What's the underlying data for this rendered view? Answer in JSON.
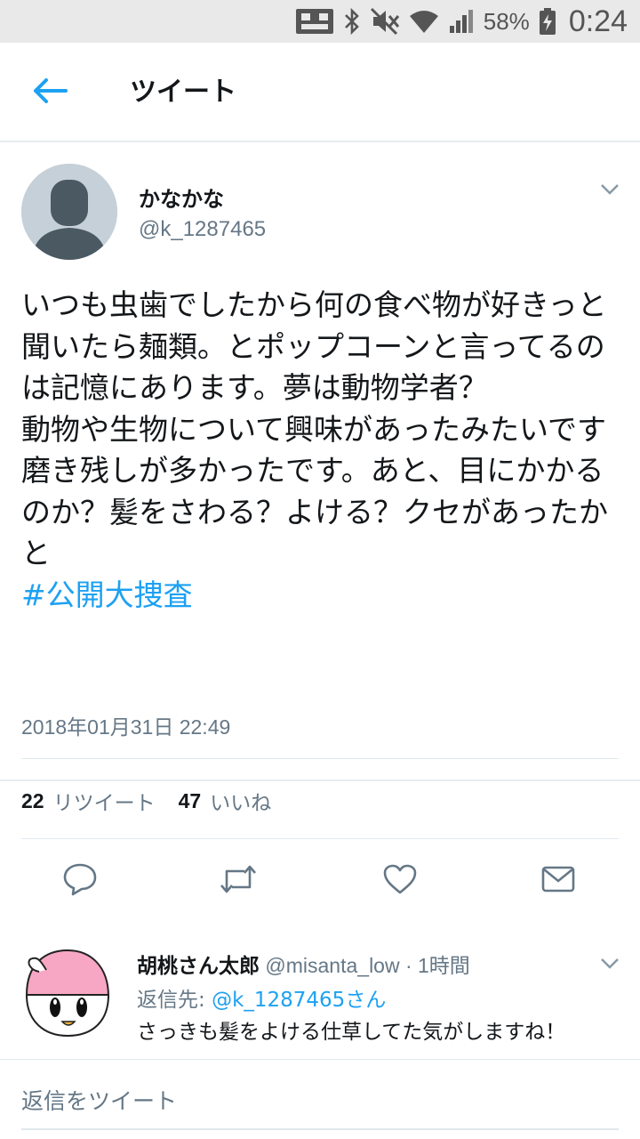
{
  "status_bar": {
    "battery_percent": "58%",
    "time": "0:24",
    "icons": [
      "sim-card-icon",
      "bluetooth-icon",
      "mute-icon",
      "wifi-icon",
      "signal-icon",
      "battery-charging-icon"
    ]
  },
  "app_bar": {
    "title": "ツイート",
    "back_icon": "arrow-left-icon"
  },
  "tweet": {
    "display_name": "かなかな",
    "screen_name": "@k_1287465",
    "text": "いつも虫歯でしたから何の食べ物が好きっと聞いたら麺類。とポップコーンと言ってるのは記憶にあります。夢は動物学者？\n動物や生物について興味があったみたいです\n磨き残しが多かったです。あと、目にかかるのか？髪をさわる？よける？クセがあったかと\n",
    "hashtag": "#公開大捜査",
    "timestamp": "2018年01月31日 22:49",
    "retweet_count": "22",
    "retweet_label": "リツイート",
    "like_count": "47",
    "like_label": "いいね",
    "actions": [
      "reply-icon",
      "retweet-icon",
      "like-icon",
      "share-mail-icon"
    ]
  },
  "reply": {
    "display_name": "胡桃さん太郎",
    "meta": " @misanta_low · 1時間",
    "reply_to_label": "返信先: ",
    "reply_to_handle": "@k_1287465さん",
    "text": "さっきも髪をよける仕草してた気がしますね！"
  },
  "compose": {
    "placeholder": "返信をツイート"
  },
  "colors": {
    "accent": "#1da1f2",
    "secondary_text": "#657786",
    "primary_text": "#14171a",
    "status_bar_bg": "#e9e9e9",
    "reply_avatar_pink": "#f7a7c4"
  }
}
